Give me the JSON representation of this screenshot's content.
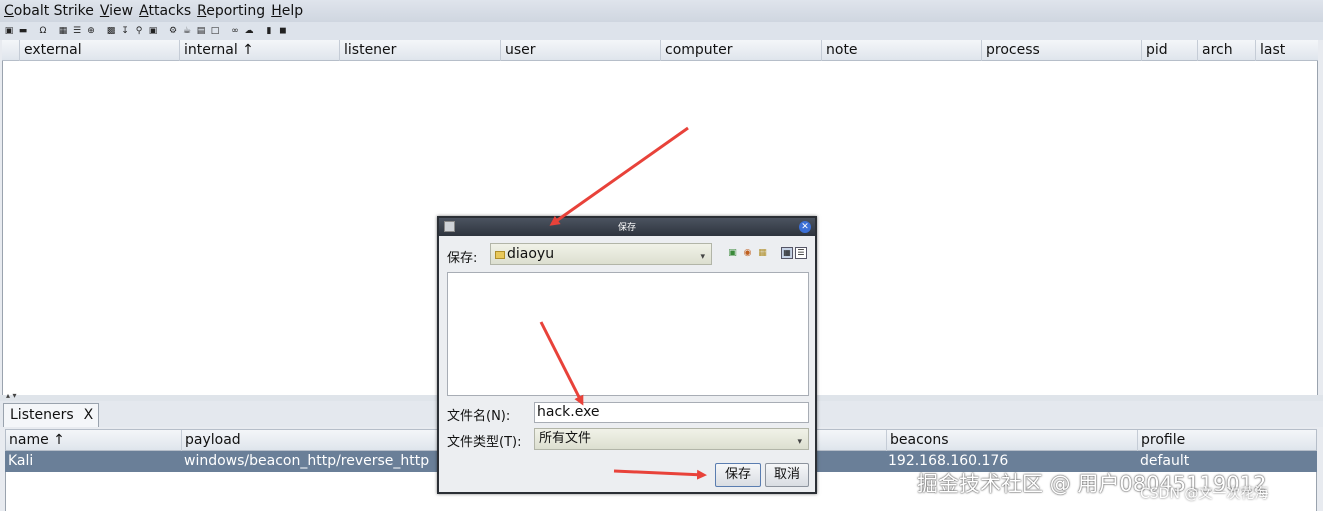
{
  "menubar": {
    "items": [
      {
        "first": "C",
        "rest": "obalt Strike"
      },
      {
        "first": "V",
        "rest": "iew"
      },
      {
        "first": "A",
        "rest": "ttacks"
      },
      {
        "first": "R",
        "rest": "eporting"
      },
      {
        "first": "H",
        "rest": "elp"
      }
    ]
  },
  "toolbar": {
    "icons": [
      "add-icon",
      "remove-icon",
      "headphones-icon",
      "pivot-graph-icon",
      "session-list-icon",
      "target-icon",
      "credentials-icon",
      "download-icon",
      "key-icon",
      "screenshot-icon",
      "settings-icon",
      "coffee-icon",
      "clipboard-icon",
      "log-icon",
      "link-icon",
      "cloud-icon",
      "book-icon",
      "package-icon"
    ]
  },
  "beacon_table": {
    "columns": [
      "",
      "external",
      "internal ↑",
      "listener",
      "user",
      "computer",
      "note",
      "process",
      "pid",
      "arch",
      "last"
    ]
  },
  "bottom_panel": {
    "tab_label": "Listeners",
    "tab_close": "X",
    "columns": {
      "name": "name ↑",
      "payload": "payload",
      "beacons": "beacons",
      "profile": "profile"
    },
    "rows": [
      {
        "name": "Kali",
        "payload": "windows/beacon_http/reverse_http",
        "beacons": "192.168.160.176",
        "profile": "default"
      }
    ]
  },
  "dialog": {
    "title": "保存",
    "save_in_label": "保存:",
    "folder": "diaoyu",
    "filename_label": "文件名(N):",
    "filename_value": "hack.exe",
    "filetype_label": "文件类型(T):",
    "filetype_value": "所有文件",
    "save_button": "保存",
    "cancel_button": "取消"
  },
  "watermark": {
    "text": "掘金技术社区 @ 用户08045119012",
    "csdn": "CSDN @文一次花海"
  },
  "colors": {
    "selected_row": "#6a7f98",
    "arrow": "#e8423a",
    "title_bar": "#2e343d"
  }
}
